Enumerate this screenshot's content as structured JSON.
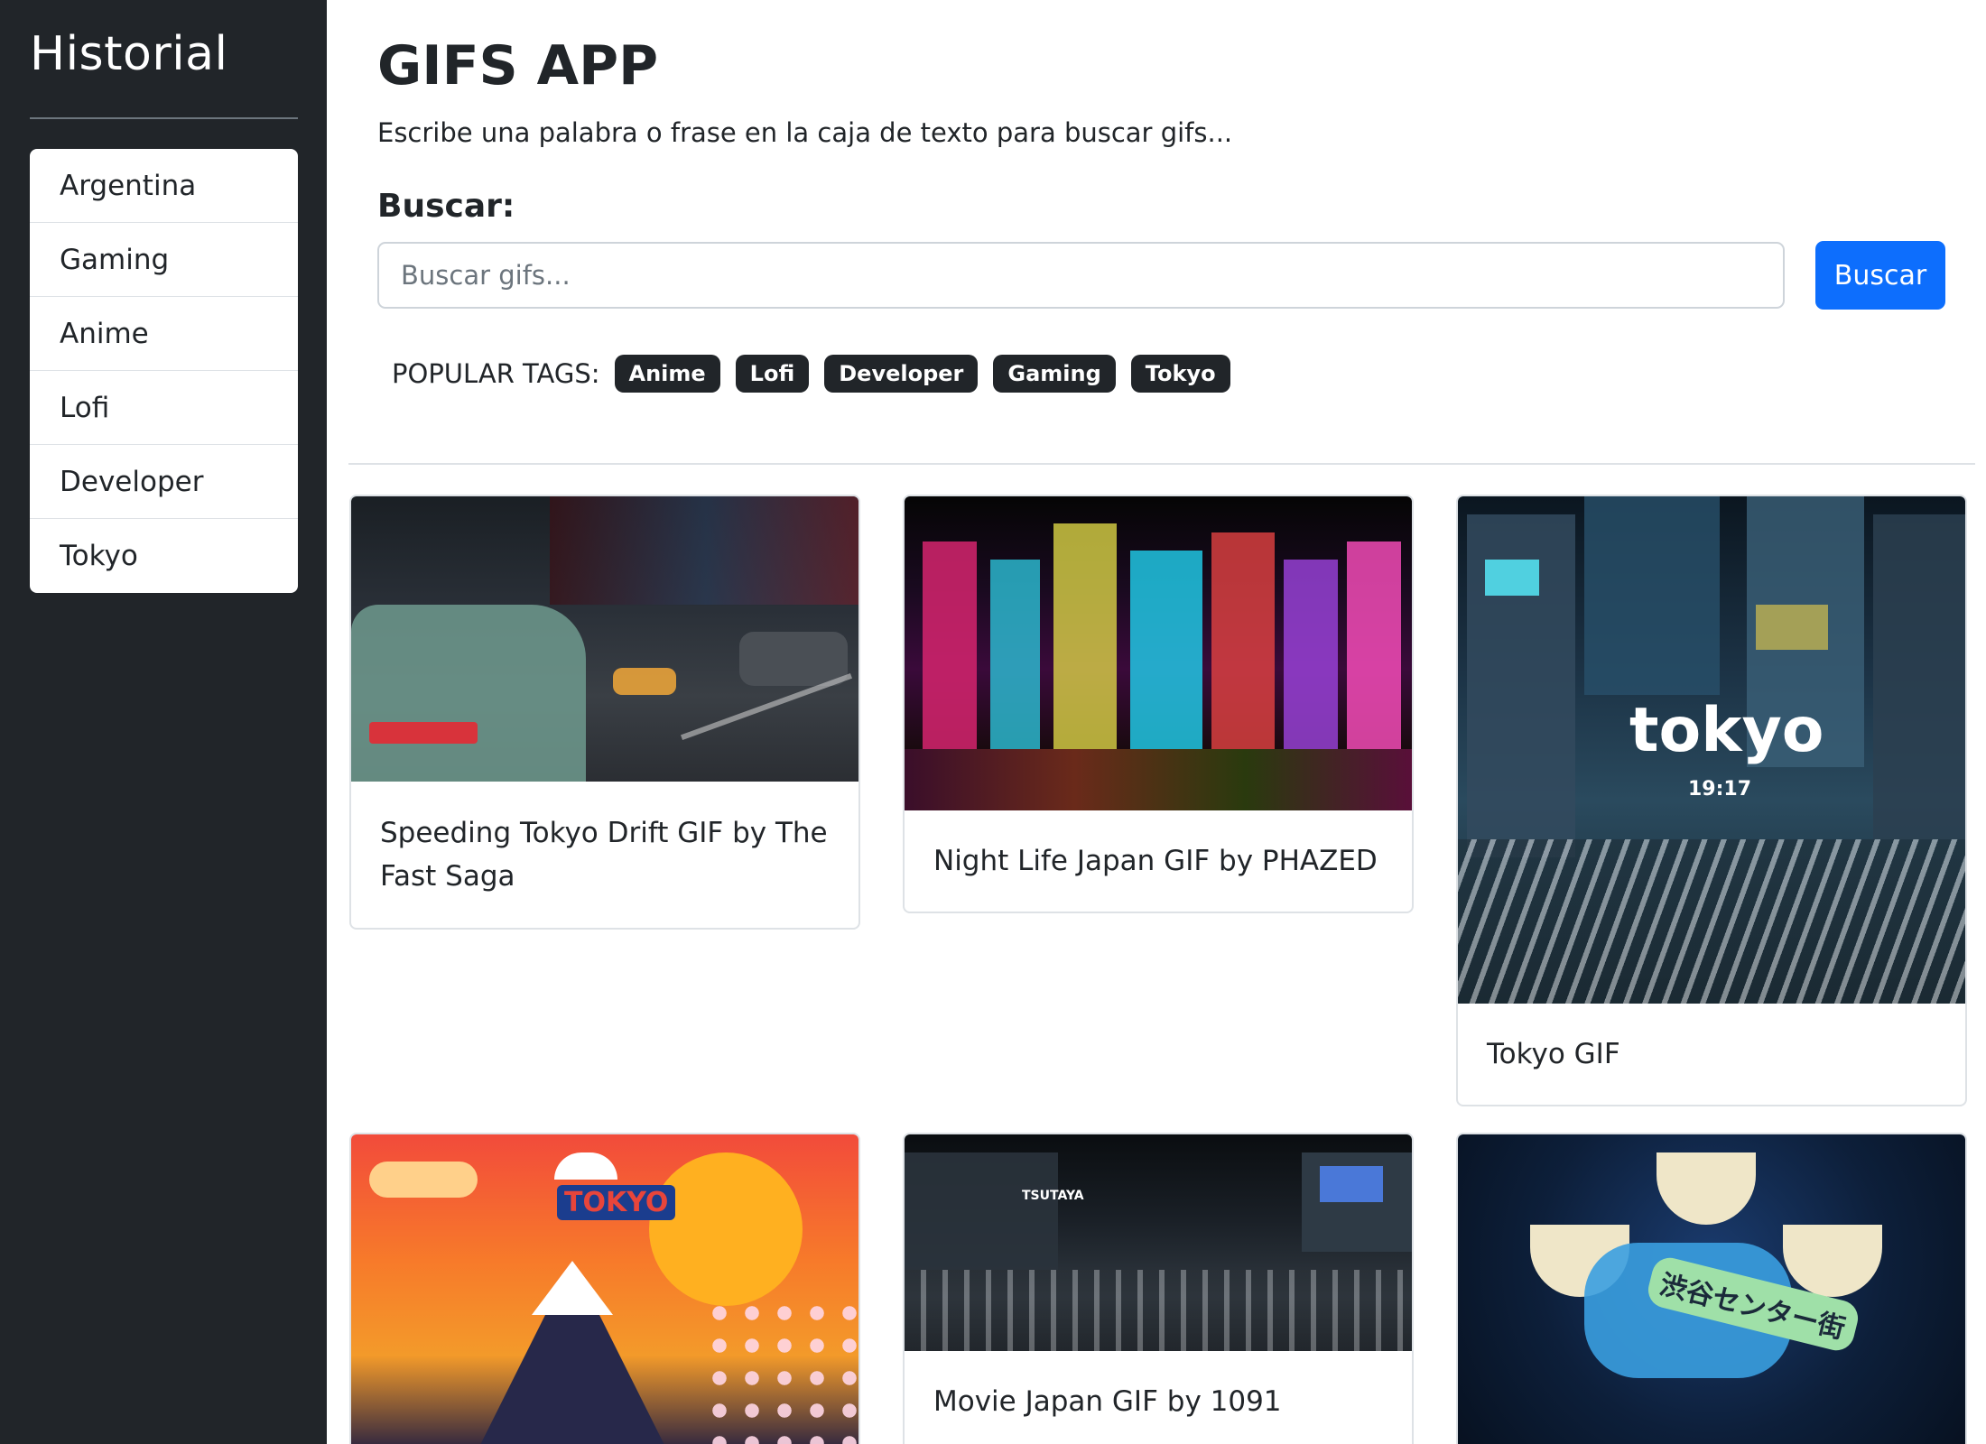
{
  "sidebar": {
    "title": "Historial",
    "items": [
      "Argentina",
      "Gaming",
      "Anime",
      "Lofi",
      "Developer",
      "Tokyo"
    ]
  },
  "header": {
    "title": "GIFS APP",
    "subtitle": "Escribe una palabra o frase en la caja de texto para buscar gifs..."
  },
  "search": {
    "label": "Buscar:",
    "placeholder": "Buscar gifs...",
    "value": "",
    "button_label": "Buscar"
  },
  "tags": {
    "label": "POPULAR TAGS:",
    "items": [
      "Anime",
      "Lofi",
      "Developer",
      "Gaming",
      "Tokyo"
    ]
  },
  "results": [
    {
      "title": "Speeding Tokyo Drift GIF by The Fast Saga"
    },
    {
      "title": "Night Life Japan GIF by PHAZED"
    },
    {
      "title": "Tokyo GIF",
      "overlay": {
        "word": "tokyo",
        "time": "19:17"
      }
    },
    {
      "title": "",
      "overlay": {
        "word": "TOKYO"
      }
    },
    {
      "title": "Movie Japan GIF by 1091",
      "overlay": {
        "word": "TSUTAYA"
      }
    },
    {
      "title": "",
      "overlay": {
        "word": "渋谷センター街"
      }
    }
  ],
  "colors": {
    "sidebar_bg": "#212529",
    "primary": "#0d6efd",
    "tag_bg": "#212529"
  }
}
